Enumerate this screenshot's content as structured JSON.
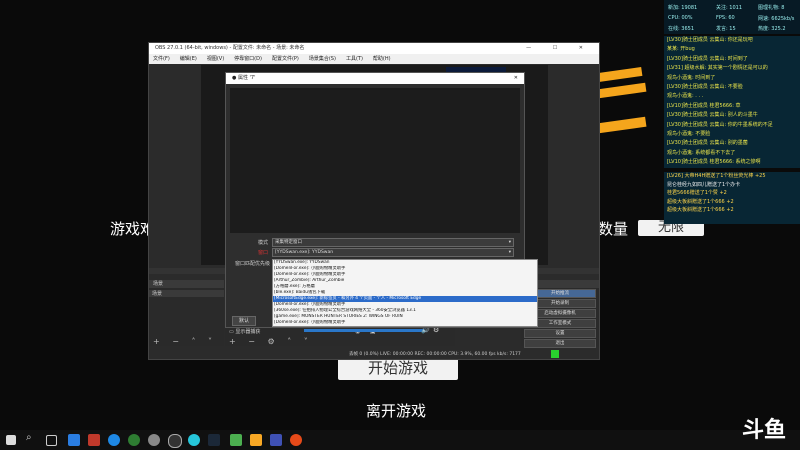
{
  "game": {
    "text_left": "游戏难",
    "text_right": "数量",
    "count_value": "无限",
    "start_button": "开始游戏",
    "leave_text": "离开游戏"
  },
  "obs": {
    "title": "OBS 27.0.1 (64-bit, windows) - 配置文件: 未命名 - 场景: 未命名",
    "menu": [
      "文件(F)",
      "编辑(E)",
      "视图(V)",
      "停靠窗口(D)",
      "配置文件(P)",
      "场景集合(S)",
      "工具(T)",
      "帮助(H)"
    ],
    "scenes_title": "场景",
    "scene_item": "场景",
    "sources_title": "来源",
    "source_item": "显示器捕获",
    "controls_title": "控件",
    "controls": [
      "开始推流",
      "开始录制",
      "启动虚拟摄像机",
      "工作室模式",
      "设置",
      "退出"
    ],
    "status": "丢帧 0 (0.0%)   LIVE: 00:00:00   REC: 00:00:00   CPU: 3.9%, 60.00 fps   kb/s: 7177"
  },
  "dialog": {
    "title": "属性 '7'",
    "mode_label": "模式",
    "mode_value": "采集特定窗口",
    "window_label": "窗口",
    "window_value": "[YYDSwan.exe]: YYDSwan",
    "hook_label": "窗口匹配优先级",
    "list": [
      "[YYDSwan.exe]: YYDSwan",
      "[DomenFor.exe]: 小鹿购物精灵助手",
      "[DomenFor.exe]: 小鹿购物精灵助手",
      "[Arthur_Zombie]: Arthur_Zombie",
      "[方格蘑.exe]: 方格蘑",
      "[ble.exe]: Baidu钱包下载",
      "[MicrosoftEdge.exe]: 新标签页 - 和另外 4 个页面 - 个人 - Microsoft Edge",
      "[DomenFor.exe]: 小鹿购物精灵助手",
      "[360se.exe]: 任拍排入物理公全综合游戏网络大全 - 360安全浏览器 13.1",
      "[game.exe]: MONSTER HUNTER STORIES 2: WINGS OF RUIN",
      "[DomenFor.exe]: 小鹿购物精灵助手"
    ],
    "selected_index": 6,
    "defaults_button": "默认"
  },
  "stats": {
    "fans": "新加: 19081",
    "follow": "关注: 1011",
    "gifts": "图理礼物: 8",
    "cpu": "CPU: 00%",
    "fps": "FPS: 60",
    "bitrate": "网速: 6625kb/s",
    "online": "在线: 3651",
    "clip": "发言: 15",
    "view": "热度: 325.2"
  },
  "chat": [
    "[LV30]骑士团成员 云集山: 你还是玩吧",
    "某某: 开bug",
    "[LV30]骑士团成员 云集山: 时间到了",
    "[LV31] 超级水解: 其实第一个剧情还是可以的",
    "观鸟小酒鬼: 时间到了",
    "[LV30]骑士团成员 云集山: 不要脸",
    "观鸟小酒鬼: . . .",
    "[LV10]骑士团成员 桂君5666: 草",
    "[LV30]骑士团成员 云集山: 别人的斗墨牛",
    "[LV30]骑士团成员 云集山: 你的牛墨系统的不足",
    "观鸟小酒鬼: 不要脸",
    "[LV30]骑士团成员 云集山: 别的墨菌",
    "观鸟小酒鬼: 系统都看不下去了",
    "[LV10]骑士团成员 桂君5666: 系统之惨啊"
  ],
  "gift_feed": [
    "[LV26] 大帝H4H赠送了1个粉丝荧光棒 +25",
    "昆仑桂经九如四儿赠送了1个办卡",
    "桂君5666赠送了1个赞 +2",
    "超级大板斜赠送了1个666 +2",
    "超级大板斜赠送了1个666 +2"
  ],
  "logo": "斗鱼",
  "colors": {
    "accent_orange": "#f5a51c",
    "obs_selection": "#2c6bc9",
    "chat_yellow": "#e8e34b"
  }
}
